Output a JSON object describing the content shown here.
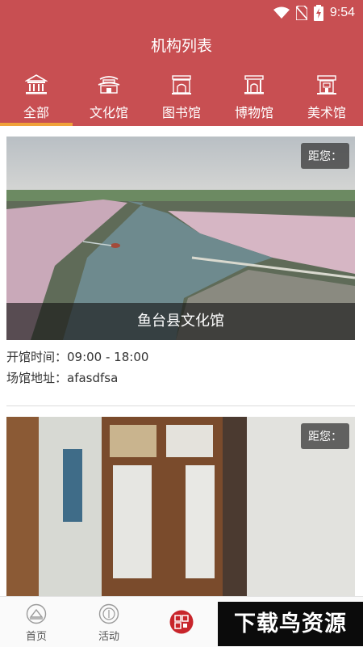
{
  "status_bar": {
    "time": "9:54"
  },
  "header": {
    "title": "机构列表"
  },
  "tabs": [
    {
      "label": "全部",
      "active": true
    },
    {
      "label": "文化馆",
      "active": false
    },
    {
      "label": "图书馆",
      "active": false
    },
    {
      "label": "博物馆",
      "active": false
    },
    {
      "label": "美术馆",
      "active": false
    }
  ],
  "venues": [
    {
      "name": "鱼台县文化馆",
      "distance_label": "距您：",
      "hours_label": "开馆时间：09:00 - 18:00",
      "address_label": "场馆地址：afasdfsa"
    },
    {
      "name": "",
      "distance_label": "距您："
    }
  ],
  "bottom_nav": [
    {
      "label": "首页",
      "icon": "home-icon"
    },
    {
      "label": "活动",
      "icon": "activity-icon"
    },
    {
      "label": "",
      "icon": "qr-icon"
    }
  ],
  "watermark": "下载鸟资源",
  "colors": {
    "primary": "#c84f52",
    "tab_indicator": "#f0a23a"
  }
}
